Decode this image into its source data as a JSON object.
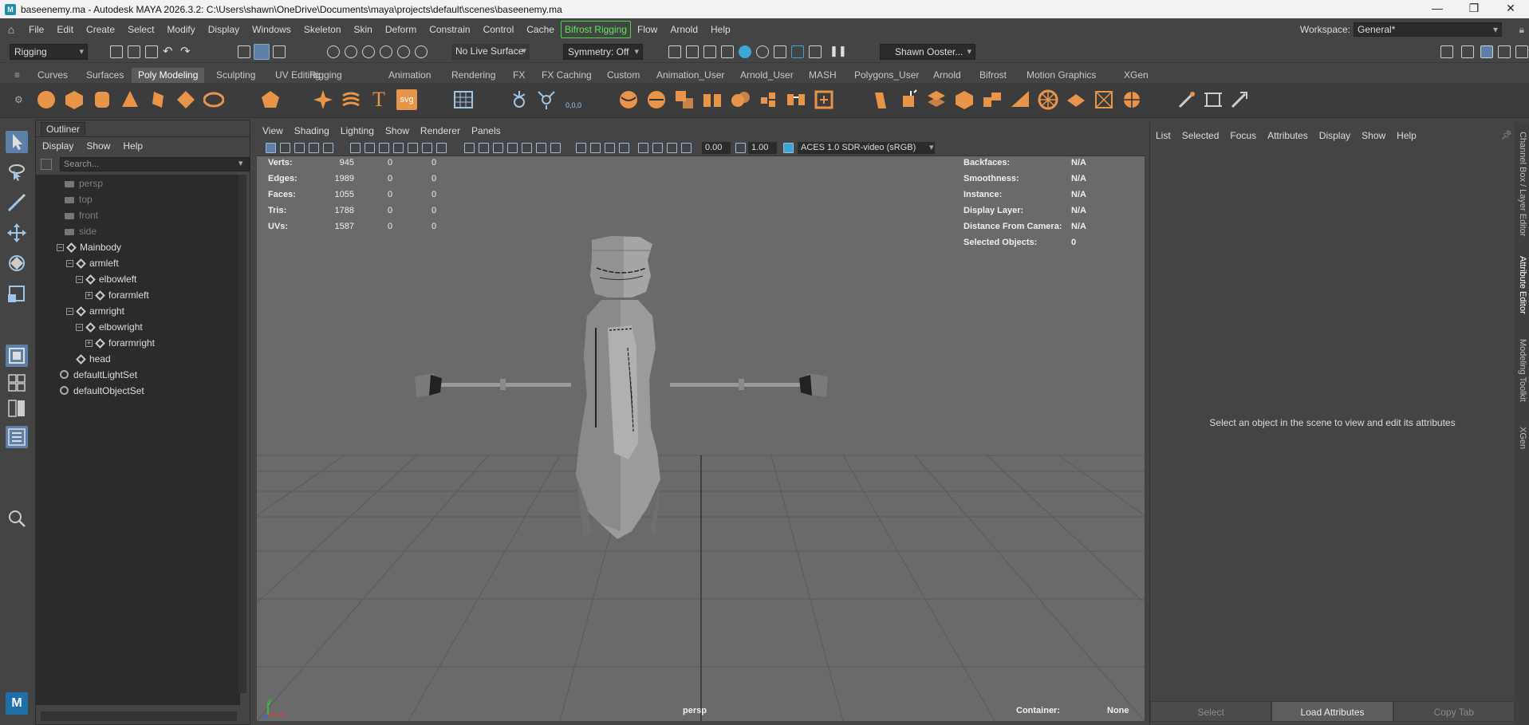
{
  "window": {
    "title": "baseenemy.ma - Autodesk MAYA 2026.3.2: C:\\Users\\shawn\\OneDrive\\Documents\\maya\\projects\\default\\scenes\\baseenemy.ma",
    "min": "—",
    "max": "❐",
    "close": "✕"
  },
  "menubar": {
    "items": [
      "File",
      "Edit",
      "Create",
      "Select",
      "Modify",
      "Display",
      "Windows",
      "Skeleton",
      "Skin",
      "Deform",
      "Constrain",
      "Control",
      "Cache",
      "Bifrost Rigging",
      "Flow",
      "Arnold",
      "Help"
    ],
    "workspace_label": "Workspace:",
    "workspace_value": "General*"
  },
  "statusline": {
    "menuset": "Rigging",
    "live_surface": "No Live Surface",
    "symmetry": "Symmetry: Off",
    "user": "Shawn Ooster..."
  },
  "shelf": {
    "tabs": [
      "Curves",
      "Surfaces",
      "Poly Modeling",
      "Sculpting",
      "UV Editing",
      "Rigging",
      "Animation",
      "Rendering",
      "FX",
      "FX Caching",
      "Custom",
      "Animation_User",
      "Arnold_User",
      "MASH",
      "Polygons_User",
      "Arnold",
      "Bifrost",
      "Motion Graphics",
      "XGen"
    ],
    "active_tab": "Poly Modeling",
    "text_icons": {
      "T": "T",
      "svg": "svg",
      "coord": "0,0,0"
    }
  },
  "outliner": {
    "title": "Outliner",
    "menu": [
      "Display",
      "Show",
      "Help"
    ],
    "search_placeholder": "Search...",
    "nodes": {
      "persp": "persp",
      "top": "top",
      "front": "front",
      "side": "side",
      "mainbody": "Mainbody",
      "armleft": "armleft",
      "elbowleft": "elbowleft",
      "forarmleft": "forarmleft",
      "armright": "armright",
      "elbowright": "elbowright",
      "forarmright": "forarmright",
      "head": "head",
      "lightset": "defaultLightSet",
      "objectset": "defaultObjectSet"
    }
  },
  "viewport": {
    "menu": [
      "View",
      "Shading",
      "Lighting",
      "Show",
      "Renderer",
      "Panels"
    ],
    "field_a": "0.00",
    "field_b": "1.00",
    "colorspace": "ACES 1.0 SDR-video (sRGB)",
    "stats": [
      {
        "label": "Verts:",
        "v1": "945",
        "v2": "0",
        "v3": "0"
      },
      {
        "label": "Edges:",
        "v1": "1989",
        "v2": "0",
        "v3": "0"
      },
      {
        "label": "Faces:",
        "v1": "1055",
        "v2": "0",
        "v3": "0"
      },
      {
        "label": "Tris:",
        "v1": "1788",
        "v2": "0",
        "v3": "0"
      },
      {
        "label": "UVs:",
        "v1": "1587",
        "v2": "0",
        "v3": "0"
      }
    ],
    "info": [
      {
        "label": "Backfaces:",
        "value": "N/A"
      },
      {
        "label": "Smoothness:",
        "value": "N/A"
      },
      {
        "label": "Instance:",
        "value": "N/A"
      },
      {
        "label": "Display Layer:",
        "value": "N/A"
      },
      {
        "label": "Distance From Camera:",
        "value": "N/A"
      },
      {
        "label": "Selected Objects:",
        "value": "0"
      }
    ],
    "camera_name": "persp",
    "container_label": "Container:",
    "container_value": "None",
    "axis_y": "y",
    "axis_x": "x"
  },
  "attribute_editor": {
    "menu": [
      "List",
      "Selected",
      "Focus",
      "Attributes",
      "Display",
      "Show",
      "Help"
    ],
    "message": "Select an object in the scene to view and edit its attributes",
    "buttons": {
      "select": "Select",
      "load": "Load Attributes",
      "copy": "Copy Tab"
    }
  },
  "right_tabs": [
    "Channel Box / Layer Editor",
    "Attribute Editor",
    "Modeling Toolkit",
    "XGen"
  ],
  "colors": {
    "accent_green": "#5be85c",
    "shelf_orange": "#e8954a",
    "viewport_bg": "#6a6a6a",
    "panel_bg": "#444444"
  }
}
